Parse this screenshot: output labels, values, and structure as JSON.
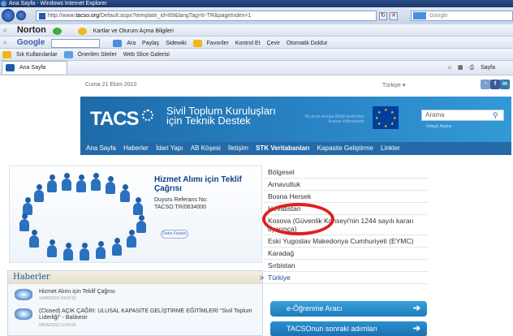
{
  "window": {
    "title": "Ana Sayfa - Windows Internet Explorer"
  },
  "address": {
    "prefix": "http://www.",
    "domain": "tacso.org",
    "path": "/Default.aspx?template_id=89&langTag=tr-TR&pageIndex=1"
  },
  "search_bar": {
    "placeholder": "Google"
  },
  "norton_bar": {
    "logo": "Norton",
    "items": [
      "Kartlar ve Oturum Açma Bilgileri"
    ]
  },
  "google_bar": {
    "logo": "Google",
    "items": [
      "Ara",
      "Paylaş",
      "Sidewiki",
      "Favoriler",
      "Kontrol Et",
      "Çevir",
      "Otomatik Doldur"
    ]
  },
  "favorites_bar": {
    "items": [
      "Sık Kullanılanlar",
      "Önerilen Siteler",
      "Web Slice Galerisi"
    ]
  },
  "tab": {
    "label": "Ana Sayfa",
    "tools": [
      "Sayfa"
    ]
  },
  "site": {
    "date": "Cuma 21 Ekim 2010",
    "language": "Türkiye",
    "logo": "TACS",
    "title_line1": "Sivil Toplum Kuruluşları",
    "title_line2": "için Teknik Destek",
    "eu_note_line1": "Bu proje Avrupa Birliği tarafından",
    "eu_note_line2": "finanse edilmektedir",
    "search_placeholder": "Arama",
    "advanced_search": "Detaylı Arama",
    "nav": [
      "Ana Sayfa",
      "Haberler",
      "İdari Yapı",
      "AB Köşesi",
      "İletişim",
      "STK Veritabanları",
      "Kapasite Geliştirme",
      "Linkler"
    ],
    "feature": {
      "title": "Hizmet Alımı için Teklif Çağrısı",
      "ref_label": "Duyuru Referans No:",
      "ref_value": "TACSO.TR/0634000",
      "more": "Daha Fazlası"
    },
    "news": {
      "heading": "Haberler",
      "items": [
        {
          "title": "Hizmet Alımı için Teklif Çağrısı",
          "date": "14/09/2010 04:02:53"
        },
        {
          "title": "(Closed) AÇIK ÇAĞRI: ULUSAL KAPASİTE GELİŞTİRME EĞİTİMLERİ \"Sivil Toplum Liderliği\" - Balıkesir",
          "date": "08/09/2010 12:00:00"
        }
      ]
    },
    "countries": [
      "Bölgesel",
      "Arnavutluk",
      "Bosna Hersek",
      "Hırvatistan",
      "Kosova (Güvenlik Konseyi'nin 1244 sayılı kararı uyarınca)",
      "Eski Yugoslav Makedonya Cumhuriyeti (EYMC)",
      "Karadağ",
      "Sırbistan",
      "Türkiye"
    ],
    "promo1": "e-Öğrenme Aracı",
    "promo2": "TACSOnun sonraki adımları"
  },
  "colors": {
    "brand_blue": "#236aa7",
    "annotation_red": "#e0201f"
  }
}
